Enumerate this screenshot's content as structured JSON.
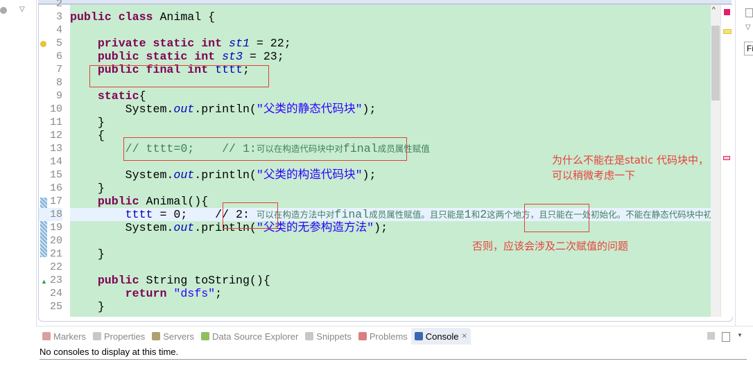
{
  "editor": {
    "lines": [
      {
        "n": "2",
        "cur": false,
        "seg": []
      },
      {
        "n": "3",
        "cur": false,
        "seg": [
          {
            "t": "public class",
            "c": "kw"
          },
          {
            "t": " Animal {",
            "c": ""
          }
        ]
      },
      {
        "n": "4",
        "cur": false,
        "seg": []
      },
      {
        "n": "5",
        "cur": false,
        "seg": [
          {
            "t": "    private static int",
            "c": "kw"
          },
          {
            "t": " ",
            "c": ""
          },
          {
            "t": "st1",
            "c": "fld"
          },
          {
            "t": " = 22;",
            "c": ""
          }
        ]
      },
      {
        "n": "6",
        "cur": false,
        "seg": [
          {
            "t": "    public static int",
            "c": "kw"
          },
          {
            "t": " ",
            "c": ""
          },
          {
            "t": "st3",
            "c": "fld"
          },
          {
            "t": " = 23;",
            "c": ""
          }
        ]
      },
      {
        "n": "7",
        "cur": false,
        "seg": [
          {
            "t": "    public final int",
            "c": "kw"
          },
          {
            "t": " ",
            "c": ""
          },
          {
            "t": "tttt",
            "c": "var"
          },
          {
            "t": ";",
            "c": ""
          }
        ]
      },
      {
        "n": "8",
        "cur": false,
        "seg": []
      },
      {
        "n": "9",
        "cur": false,
        "seg": [
          {
            "t": "    static",
            "c": "kw"
          },
          {
            "t": "{",
            "c": ""
          }
        ]
      },
      {
        "n": "10",
        "cur": false,
        "seg": [
          {
            "t": "        System.",
            "c": ""
          },
          {
            "t": "out",
            "c": "fld"
          },
          {
            "t": ".println(",
            "c": ""
          },
          {
            "t": "\"父类的静态代码块\"",
            "c": "str cnq"
          },
          {
            "t": ");",
            "c": ""
          }
        ]
      },
      {
        "n": "11",
        "cur": false,
        "seg": [
          {
            "t": "    }",
            "c": ""
          }
        ]
      },
      {
        "n": "12",
        "cur": false,
        "seg": [
          {
            "t": "    {",
            "c": ""
          }
        ]
      },
      {
        "n": "13",
        "cur": false,
        "seg": [
          {
            "t": "        // tttt=0;    // 1:",
            "c": "cm"
          },
          {
            "t": "可以在构造代码块中对",
            "c": "cm cn"
          },
          {
            "t": "final",
            "c": "cm"
          },
          {
            "t": "成员属性赋值",
            "c": "cm cn"
          }
        ]
      },
      {
        "n": "14",
        "cur": false,
        "seg": []
      },
      {
        "n": "15",
        "cur": false,
        "seg": [
          {
            "t": "        System.",
            "c": ""
          },
          {
            "t": "out",
            "c": "fld"
          },
          {
            "t": ".println(",
            "c": ""
          },
          {
            "t": "\"父类的构造代码块\"",
            "c": "str cnq"
          },
          {
            "t": ");",
            "c": ""
          }
        ]
      },
      {
        "n": "16",
        "cur": false,
        "seg": [
          {
            "t": "    }",
            "c": ""
          }
        ]
      },
      {
        "n": "17",
        "cur": false,
        "seg": [
          {
            "t": "    public",
            "c": "kw"
          },
          {
            "t": " Animal(){",
            "c": ""
          }
        ]
      },
      {
        "n": "18",
        "cur": true,
        "seg": [
          {
            "t": "        ",
            "c": ""
          },
          {
            "t": "tttt",
            "c": "var"
          },
          {
            "t": " = 0;    // 2: ",
            "c": ""
          },
          {
            "t": "可以在构造方法中对",
            "c": "cm cn"
          },
          {
            "t": "final",
            "c": "cm"
          },
          {
            "t": "成员属性赋值。且只能是",
            "c": "cm cn"
          },
          {
            "t": "1",
            "c": "cm"
          },
          {
            "t": "和",
            "c": "cm cn"
          },
          {
            "t": "2",
            "c": "cm"
          },
          {
            "t": "这两个地方，且只能在一处初始化。不能在静态代码块中初始化",
            "c": "cm cn"
          }
        ]
      },
      {
        "n": "19",
        "cur": false,
        "seg": [
          {
            "t": "        System.",
            "c": ""
          },
          {
            "t": "out",
            "c": "fld"
          },
          {
            "t": ".println(",
            "c": ""
          },
          {
            "t": "\"父类的无参构造方法\"",
            "c": "str cnq"
          },
          {
            "t": ");",
            "c": ""
          }
        ]
      },
      {
        "n": "20",
        "cur": false,
        "seg": []
      },
      {
        "n": "21",
        "cur": false,
        "seg": [
          {
            "t": "    }",
            "c": ""
          }
        ]
      },
      {
        "n": "22",
        "cur": false,
        "seg": []
      },
      {
        "n": "23",
        "cur": false,
        "seg": [
          {
            "t": "    public",
            "c": "kw"
          },
          {
            "t": " String toString(){",
            "c": ""
          }
        ]
      },
      {
        "n": "24",
        "cur": false,
        "seg": [
          {
            "t": "        return",
            "c": "kw"
          },
          {
            "t": " ",
            "c": ""
          },
          {
            "t": "\"dsfs\"",
            "c": "str"
          },
          {
            "t": ";",
            "c": ""
          }
        ]
      },
      {
        "n": "25",
        "cur": false,
        "seg": [
          {
            "t": "    }",
            "c": ""
          }
        ]
      }
    ]
  },
  "annotations": {
    "note1_line1": "为什么不能在是static 代码块中，",
    "note1_line2": "可以稍微考虑一下",
    "note2": "否则，应该会涉及二次赋值的问题"
  },
  "right_panel": {
    "find_label": "Fi"
  },
  "bottom_panel": {
    "tabs": [
      {
        "label": "Markers",
        "icon": "markers-icon",
        "color": "#d9a0a0"
      },
      {
        "label": "Properties",
        "icon": "properties-icon",
        "color": "#c8c8c8"
      },
      {
        "label": "Servers",
        "icon": "servers-icon",
        "color": "#b0a070"
      },
      {
        "label": "Data Source Explorer",
        "icon": "data-source-icon",
        "color": "#8fbf5f"
      },
      {
        "label": "Snippets",
        "icon": "snippets-icon",
        "color": "#c8c8c8"
      },
      {
        "label": "Problems",
        "icon": "problems-icon",
        "color": "#d88080"
      },
      {
        "label": "Console",
        "icon": "console-icon",
        "color": "#3a66b0",
        "active": true
      }
    ],
    "close_glyph": "✕",
    "console_message": "No consoles to display at this time."
  }
}
